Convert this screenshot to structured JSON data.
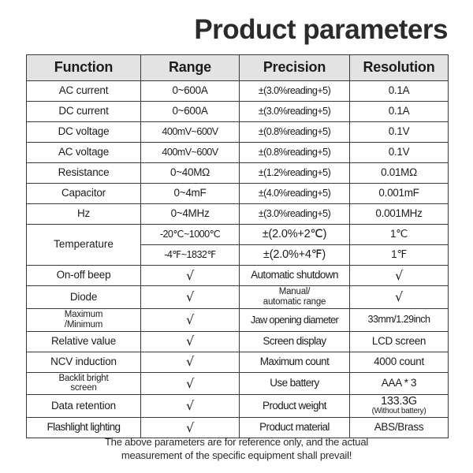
{
  "page_title": "Product parameters",
  "colors": {
    "label_bg": "#e3e3e3",
    "border": "#3a3a3a",
    "text": "#1c1c1c",
    "title_text": "#2b2b2b",
    "page_bg": "#ffffff"
  },
  "table": {
    "headers": {
      "function": "Function",
      "range": "Range",
      "precision": "Precision",
      "resolution": "Resolution"
    },
    "measurement_rows": [
      {
        "function": "AC current",
        "range": "0~600A",
        "precision": "±(3.0%reading+5)",
        "resolution": "0.1A"
      },
      {
        "function": "DC current",
        "range": "0~600A",
        "precision": "±(3.0%reading+5)",
        "resolution": "0.1A"
      },
      {
        "function": "DC voltage",
        "range": "400mV~600V",
        "precision": "±(0.8%reading+5)",
        "resolution": "0.1V"
      },
      {
        "function": "AC voltage",
        "range": "400mV~600V",
        "precision": "±(0.8%reading+5)",
        "resolution": "0.1V"
      },
      {
        "function": "Resistance",
        "range": "0~40MΩ",
        "precision": "±(1.2%reading+5)",
        "resolution": "0.01MΩ"
      },
      {
        "function": "Capacitor",
        "range": "0~4mF",
        "precision": "±(4.0%reading+5)",
        "resolution": "0.001mF"
      },
      {
        "function": "Hz",
        "range": "0~4MHz",
        "precision": "±(3.0%reading+5)",
        "resolution": "0.001MHz"
      }
    ],
    "temperature": {
      "function": "Temperature",
      "sub_rows": [
        {
          "range": "-20℃~1000℃",
          "precision": "±(2.0%+2℃)",
          "resolution": "1℃"
        },
        {
          "range": "-4℉~1832℉",
          "precision": "±(2.0%+4℉)",
          "resolution": "1℉"
        }
      ]
    },
    "feature_rows": [
      {
        "left_label": "On-off beep",
        "left_value": "√",
        "right_label": "Automatic shutdown",
        "right_value": "√"
      },
      {
        "left_label": "Diode",
        "left_value": "√",
        "right_label": "Manual/\nautomatic range",
        "right_value": "√"
      },
      {
        "left_label": "Maximum\n/Minimum",
        "left_value": "√",
        "right_label": "Jaw opening diameter",
        "right_value": "33mm/1.29inch"
      },
      {
        "left_label": "Relative value",
        "left_value": "√",
        "right_label": "Screen display",
        "right_value": "LCD screen"
      },
      {
        "left_label": "NCV induction",
        "left_value": "√",
        "right_label": "Maximum count",
        "right_value": "4000 count"
      },
      {
        "left_label": "Backlit bright\nscreen",
        "left_value": "√",
        "right_label": "Use battery",
        "right_value": "AAA * 3"
      },
      {
        "left_label": "Data retention",
        "left_value": "√",
        "right_label": "Product weight",
        "right_value": "133.3G",
        "right_value_sub": "(Without battery)"
      },
      {
        "left_label": "Flashlight lighting",
        "left_value": "√",
        "right_label": "Product material",
        "right_value": "ABS/Brass"
      }
    ]
  },
  "footer": {
    "line1": "The above parameters are for reference only, and the actual",
    "line2": "measurement of the specific equipment shall prevail!"
  }
}
